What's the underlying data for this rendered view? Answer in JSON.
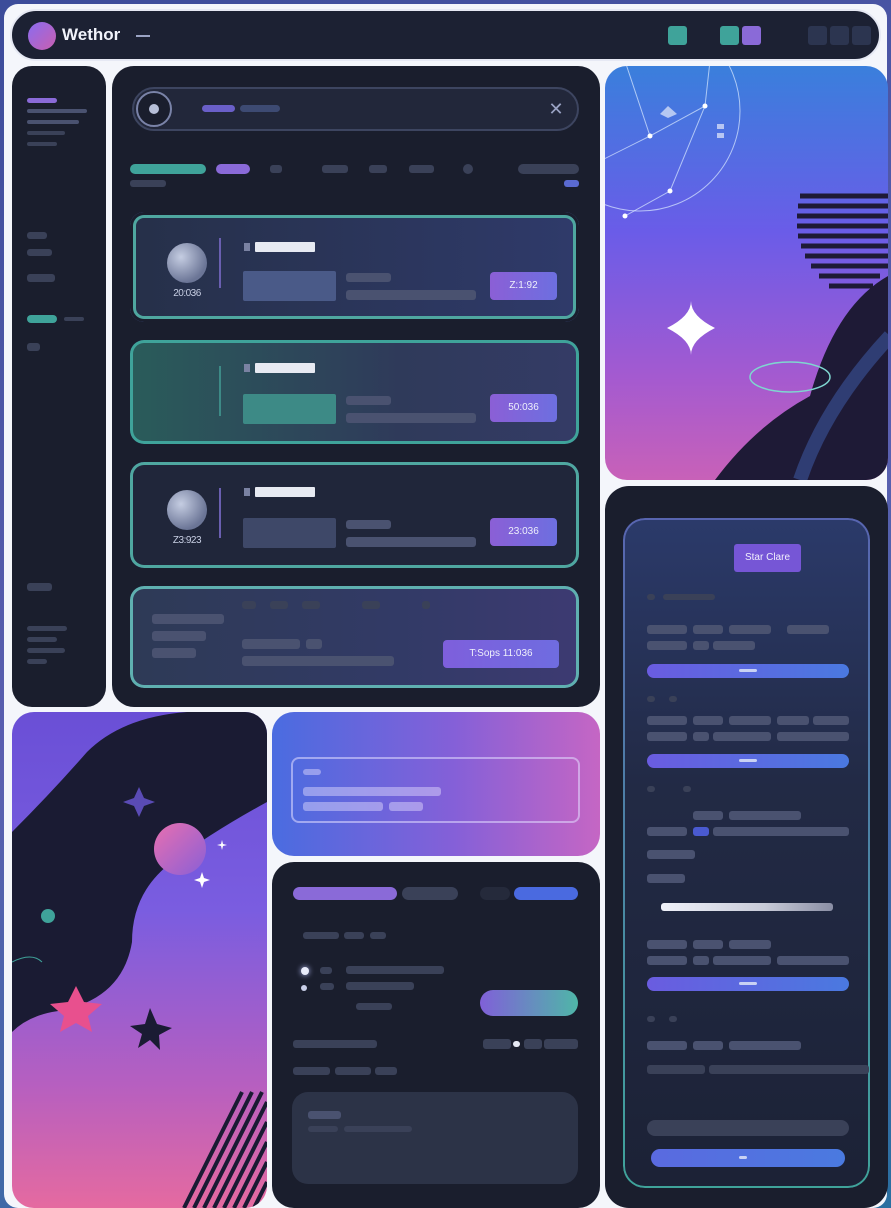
{
  "header": {
    "app_title": "Wethor",
    "square_colors": [
      "#3fa39a",
      "#3fa39a",
      "#8a6ad8",
      "#2c3550",
      "#2c3550",
      "#2c3550"
    ]
  },
  "main": {
    "cards": [
      {
        "code": "20:036",
        "button": "Z:1:92",
        "has_avatar": true
      },
      {
        "code": "",
        "button": "50:036",
        "has_avatar": false
      },
      {
        "code": "Z3:923",
        "button": "23:036",
        "has_avatar": true
      }
    ],
    "summary_button": "T:Sops 11:036"
  },
  "phone": {
    "start_chip": "Star Clare"
  },
  "colors": {
    "accent_teal": "#3fa39a",
    "accent_purple": "#7656d6",
    "panel_bg": "#1a1e2d"
  }
}
